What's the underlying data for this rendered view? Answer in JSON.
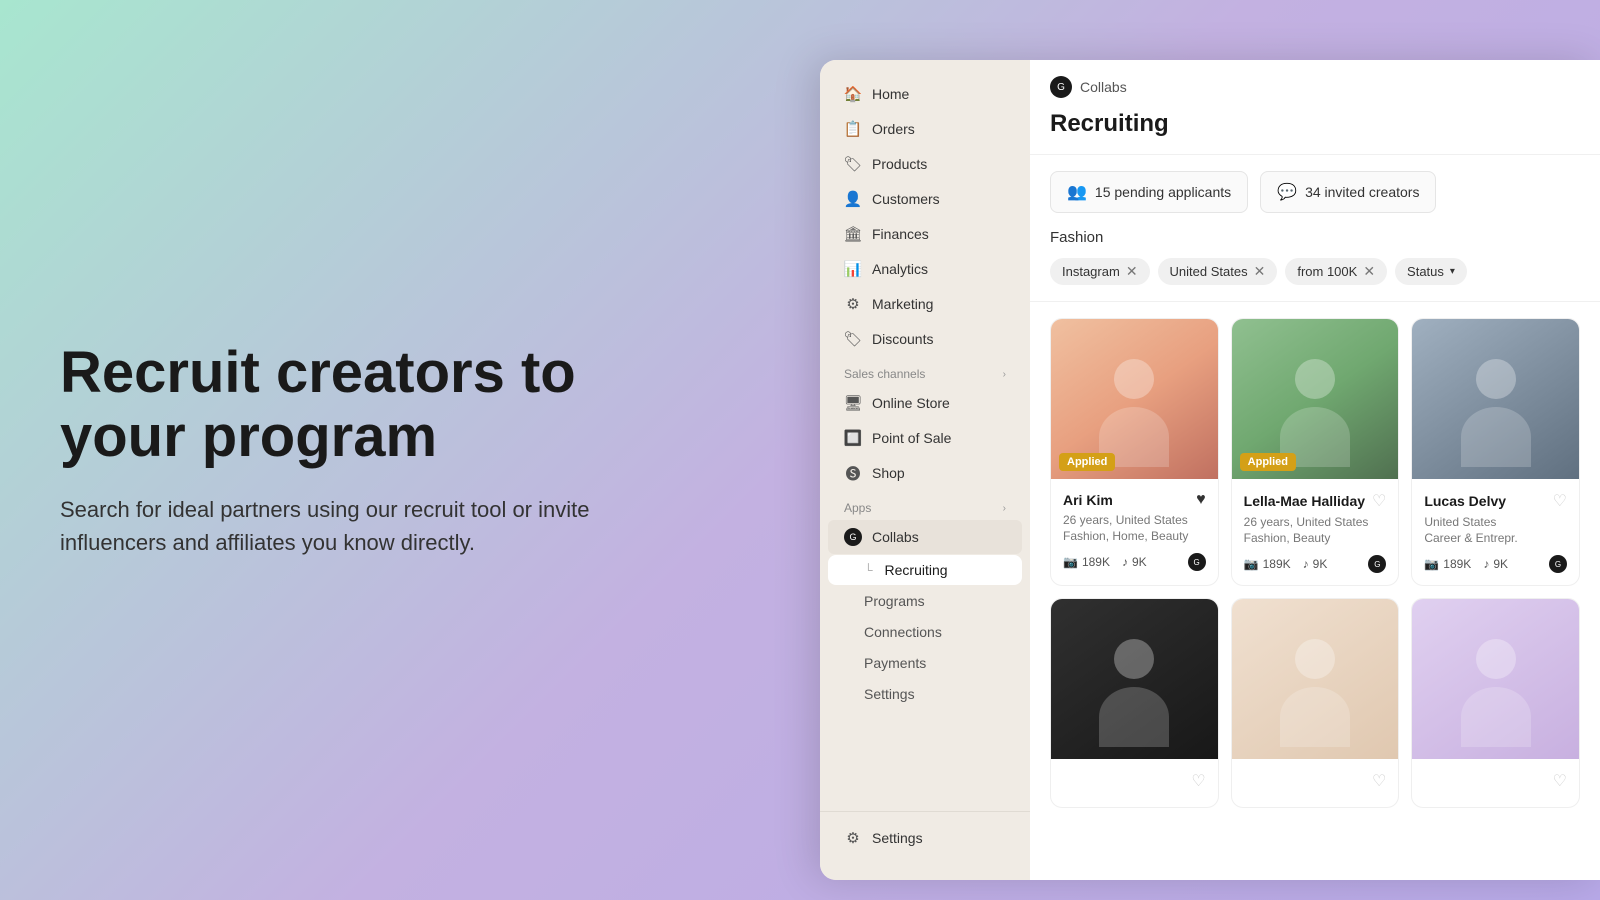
{
  "hero": {
    "title": "Recruit creators to your program",
    "subtitle": "Search for ideal partners using our recruit tool or invite influencers and affiliates you know directly."
  },
  "sidebar": {
    "nav_items": [
      {
        "id": "home",
        "label": "Home",
        "icon": "🏠"
      },
      {
        "id": "orders",
        "label": "Orders",
        "icon": "📋"
      },
      {
        "id": "products",
        "label": "Products",
        "icon": "🏷"
      },
      {
        "id": "customers",
        "label": "Customers",
        "icon": "👤"
      },
      {
        "id": "finances",
        "label": "Finances",
        "icon": "🏛"
      },
      {
        "id": "analytics",
        "label": "Analytics",
        "icon": "📊"
      },
      {
        "id": "marketing",
        "label": "Marketing",
        "icon": "⚙"
      },
      {
        "id": "discounts",
        "label": "Discounts",
        "icon": "🏷"
      }
    ],
    "sales_channels_label": "Sales channels",
    "sales_channels": [
      {
        "id": "online-store",
        "label": "Online Store",
        "icon": "🖥"
      },
      {
        "id": "point-of-sale",
        "label": "Point of Sale",
        "icon": "🔲"
      },
      {
        "id": "shop",
        "label": "Shop",
        "icon": "🅢"
      }
    ],
    "apps_label": "Apps",
    "apps": [
      {
        "id": "collabs",
        "label": "Collabs",
        "icon": "●"
      }
    ],
    "sub_items": [
      {
        "id": "recruiting",
        "label": "Recruiting"
      },
      {
        "id": "programs",
        "label": "Programs"
      },
      {
        "id": "connections",
        "label": "Connections"
      },
      {
        "id": "payments",
        "label": "Payments"
      },
      {
        "id": "settings-sub",
        "label": "Settings"
      }
    ],
    "settings_label": "Settings"
  },
  "header": {
    "tab_label": "Collabs",
    "page_title": "Recruiting"
  },
  "stats": {
    "pending_label": "15 pending applicants",
    "invited_label": "34 invited creators"
  },
  "filters": {
    "category": "Fashion",
    "tags": [
      {
        "id": "instagram",
        "label": "Instagram",
        "removable": true
      },
      {
        "id": "united-states",
        "label": "United States",
        "removable": true
      },
      {
        "id": "from-100k",
        "label": "from 100K",
        "removable": true
      },
      {
        "id": "status",
        "label": "Status",
        "has_dropdown": true
      }
    ]
  },
  "creators": [
    {
      "id": "ari-kim",
      "name": "Ari Kim",
      "age": "26 years",
      "location": "United States",
      "categories": "Fashion, Home, Beauty",
      "instagram": "189K",
      "tiktok": "9K",
      "applied": true,
      "liked": true,
      "img_class": "img-ari"
    },
    {
      "id": "lella-mae-halliday",
      "name": "Lella-Mae Halliday",
      "age": "26 years",
      "location": "United States",
      "categories": "Fashion, Beauty",
      "instagram": "189K",
      "tiktok": "9K",
      "applied": true,
      "liked": false,
      "img_class": "img-lella"
    },
    {
      "id": "lucas-delvy",
      "name": "Lucas Delvy",
      "age": "",
      "location": "United States",
      "categories": "Career & Entrepr.",
      "instagram": "189K",
      "tiktok": "9K",
      "applied": false,
      "liked": false,
      "img_class": "img-lucas"
    },
    {
      "id": "creator-4",
      "name": "",
      "age": "",
      "location": "",
      "categories": "",
      "instagram": "",
      "tiktok": "",
      "applied": false,
      "liked": false,
      "img_class": "img-row2-1"
    },
    {
      "id": "creator-5",
      "name": "",
      "age": "",
      "location": "",
      "categories": "",
      "instagram": "",
      "tiktok": "",
      "applied": false,
      "liked": false,
      "img_class": "img-row2-2"
    },
    {
      "id": "creator-6",
      "name": "",
      "age": "",
      "location": "",
      "categories": "",
      "instagram": "",
      "tiktok": "",
      "applied": false,
      "liked": false,
      "img_class": "img-row2-3"
    }
  ]
}
